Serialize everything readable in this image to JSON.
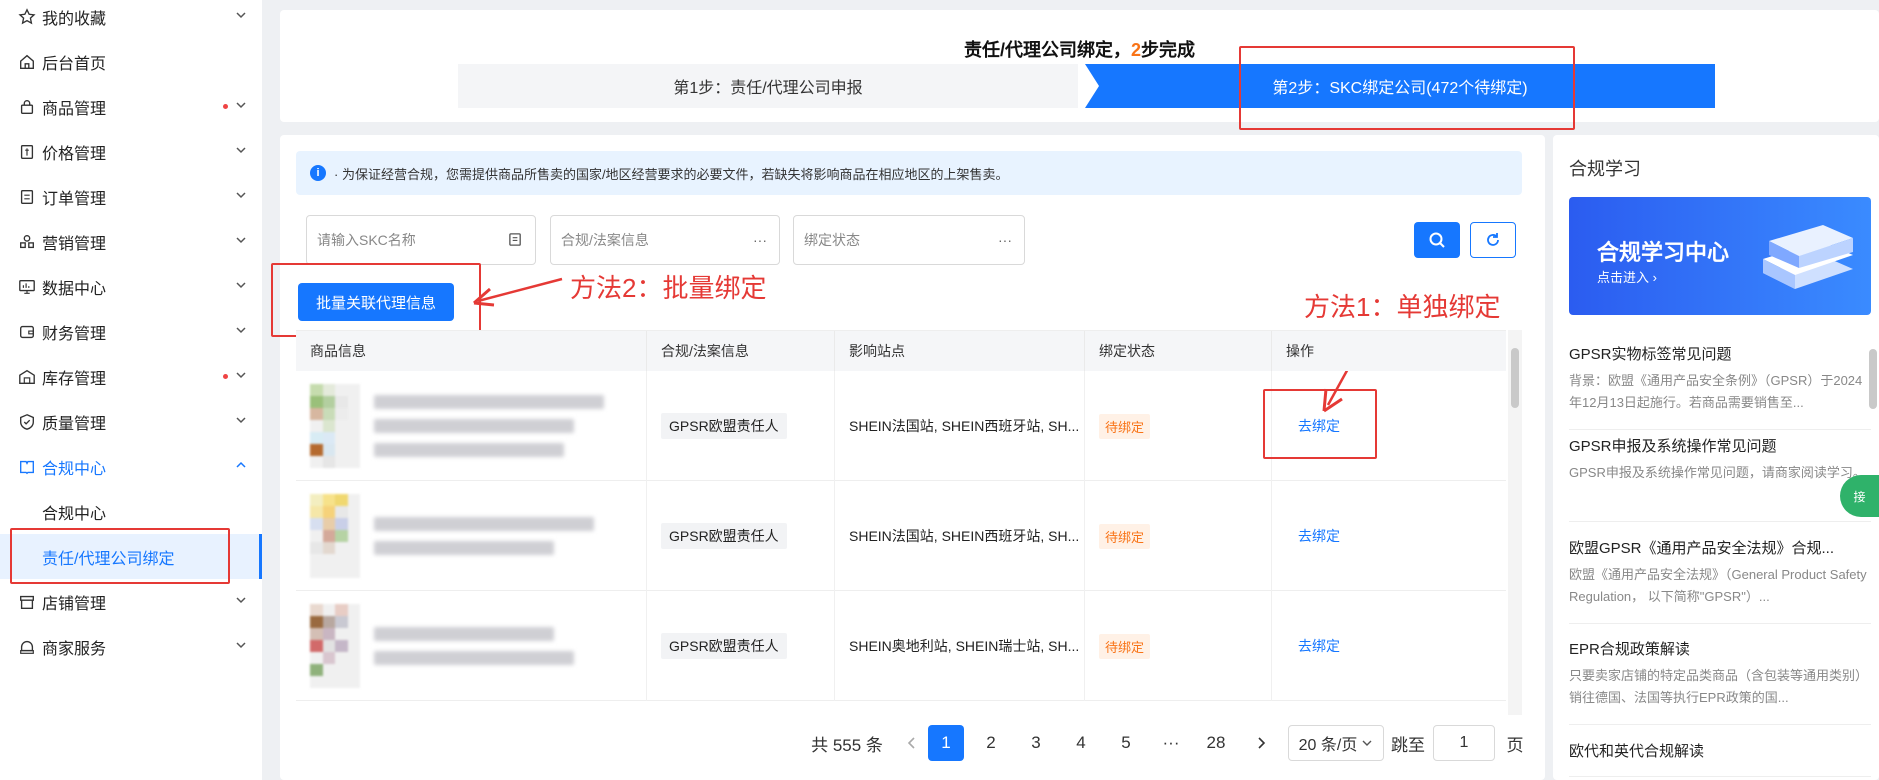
{
  "sidebar": {
    "items": [
      {
        "label": "我的收藏",
        "icon": "star-icon"
      },
      {
        "label": "后台首页",
        "icon": "home-icon"
      },
      {
        "label": "商品管理",
        "icon": "lock-bag-icon"
      },
      {
        "label": "价格管理",
        "icon": "price-tag-icon"
      },
      {
        "label": "订单管理",
        "icon": "order-list-icon"
      },
      {
        "label": "营销管理",
        "icon": "shapes-icon"
      },
      {
        "label": "数据中心",
        "icon": "monitor-icon"
      },
      {
        "label": "财务管理",
        "icon": "wallet-icon"
      },
      {
        "label": "库存管理",
        "icon": "warehouse-icon"
      },
      {
        "label": "质量管理",
        "icon": "shield-check-icon"
      },
      {
        "label": "合规中心",
        "icon": "book-icon"
      },
      {
        "label": "店铺管理",
        "icon": "store-icon"
      },
      {
        "label": "商家服务",
        "icon": "service-icon"
      }
    ],
    "sub_items": [
      {
        "label": "合规中心"
      },
      {
        "label": "责任/代理公司绑定"
      }
    ]
  },
  "steps": {
    "title_prefix": "责任/代理公司绑定，",
    "title_num": "2",
    "title_suffix": "步完成",
    "step1": "第1步：责任/代理公司申报",
    "step2": "第2步：SKC绑定公司(472个待绑定)"
  },
  "notice": {
    "text": "· 为保证经营合规，您需提供商品所售卖的国家/地区经营要求的必要文件，若缺失将影响商品在相应地区的上架售卖。"
  },
  "filters": {
    "skc_placeholder": "请输入SKC名称",
    "compliance_placeholder": "合规/法案信息",
    "status_placeholder": "绑定状态",
    "ellipsis": "···"
  },
  "actions": {
    "batch_label": "批量关联代理信息"
  },
  "annotations": {
    "method2": "方法2：批量绑定",
    "method1": "方法1：单独绑定"
  },
  "table": {
    "headers": [
      "商品信息",
      "合规/法案信息",
      "影响站点",
      "绑定状态",
      "操作"
    ],
    "rows": [
      {
        "compliance": "GPSR欧盟责任人",
        "sites": "SHEIN法国站, SHEIN西班牙站, SH...",
        "status": "待绑定",
        "action": "去绑定"
      },
      {
        "compliance": "GPSR欧盟责任人",
        "sites": "SHEIN法国站, SHEIN西班牙站, SH...",
        "status": "待绑定",
        "action": "去绑定"
      },
      {
        "compliance": "GPSR欧盟责任人",
        "sites": "SHEIN奥地利站, SHEIN瑞士站, SH...",
        "status": "待绑定",
        "action": "去绑定"
      }
    ]
  },
  "pagination": {
    "total": "共 555 条",
    "pages": [
      "1",
      "2",
      "3",
      "4",
      "5",
      "···",
      "28"
    ],
    "current": "1",
    "page_size": "20 条/页",
    "jump_label": "跳至",
    "jump_value": "1",
    "page_unit": "页"
  },
  "learn": {
    "title": "合规学习",
    "banner_title": "合规学习中心",
    "banner_sub": "点击进入 ›",
    "articles": [
      {
        "title": "GPSR实物标签常见问题",
        "desc": "背景：欧盟《通用产品安全条例》（GPSR）于2024年12月13日起施行。若商品需要销售至..."
      },
      {
        "title": "GPSR申报及系统操作常见问题",
        "desc": "GPSR申报及系统操作常见问题，请商家阅读学习。"
      },
      {
        "title": "欧盟GPSR《通用产品安全法规》合规...",
        "desc": "欧盟《通用产品安全法规》（General Product Safety Regulation， 以下简称\"GPSR\"）..."
      },
      {
        "title": "EPR合规政策解读",
        "desc": "只要卖家店铺的特定品类商品（含包装等通用类别）销往德国、法国等执行EPR政策的国..."
      },
      {
        "title": "欧代和英代合规解读",
        "desc": ""
      }
    ],
    "float_tab": "接"
  },
  "colors": {
    "accent": "#1677ff",
    "annotation": "#e53935",
    "pending": "#f97316"
  }
}
